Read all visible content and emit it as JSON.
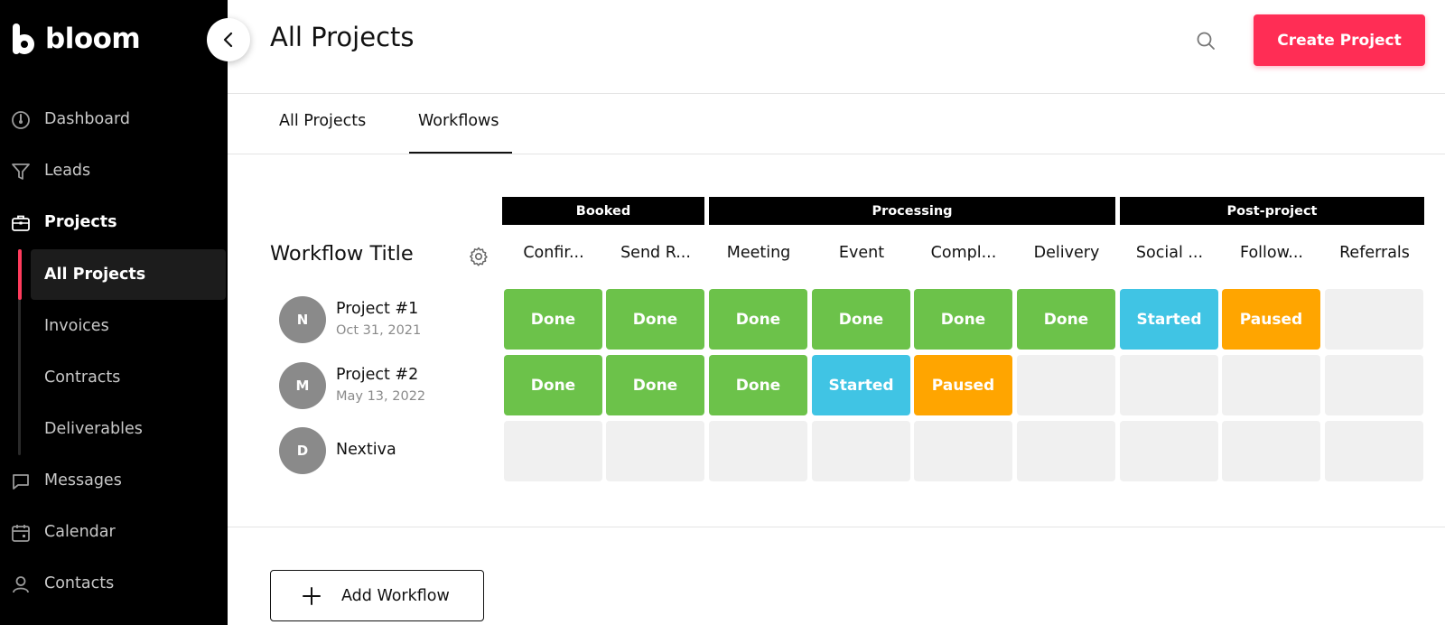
{
  "brand": {
    "name": "bloom"
  },
  "sidebar": {
    "items": [
      {
        "label": "Dashboard",
        "icon": "dashboard-icon"
      },
      {
        "label": "Leads",
        "icon": "funnel-icon"
      },
      {
        "label": "Projects",
        "icon": "briefcase-icon"
      },
      {
        "label": "Messages",
        "icon": "message-icon"
      },
      {
        "label": "Calendar",
        "icon": "calendar-icon"
      },
      {
        "label": "Contacts",
        "icon": "user-icon"
      }
    ],
    "sub_items": [
      {
        "label": "All Projects"
      },
      {
        "label": "Invoices"
      },
      {
        "label": "Contracts"
      },
      {
        "label": "Deliverables"
      }
    ]
  },
  "header": {
    "title": "All Projects",
    "create_label": "Create Project"
  },
  "tabs": [
    {
      "label": "All Projects"
    },
    {
      "label": "Workflows"
    }
  ],
  "workflow": {
    "title": "Workflow Title",
    "phases": [
      "Booked",
      "Processing",
      "Post-project"
    ],
    "columns": [
      "Confir...",
      "Send R...",
      "Meeting",
      "Event",
      "Compl...",
      "Delivery",
      "Social ...",
      "Follow...",
      "Referrals"
    ],
    "rows": [
      {
        "initial": "N",
        "name": "Project #1",
        "date": "Oct 31, 2021",
        "statuses": [
          "Done",
          "Done",
          "Done",
          "Done",
          "Done",
          "Done",
          "Started",
          "Paused",
          ""
        ]
      },
      {
        "initial": "M",
        "name": "Project #2",
        "date": "May 13, 2022",
        "statuses": [
          "Done",
          "Done",
          "Done",
          "Started",
          "Paused",
          "",
          "",
          "",
          ""
        ]
      },
      {
        "initial": "D",
        "name": "Nextiva",
        "date": "",
        "statuses": [
          "",
          "",
          "",
          "",
          "",
          "",
          "",
          "",
          ""
        ]
      }
    ],
    "add_label": "Add Workflow"
  },
  "colors": {
    "accent": "#ff2d55",
    "done": "#6cc24a",
    "started": "#40c4e4",
    "paused": "#ffa500",
    "empty": "#f0f0f0"
  }
}
